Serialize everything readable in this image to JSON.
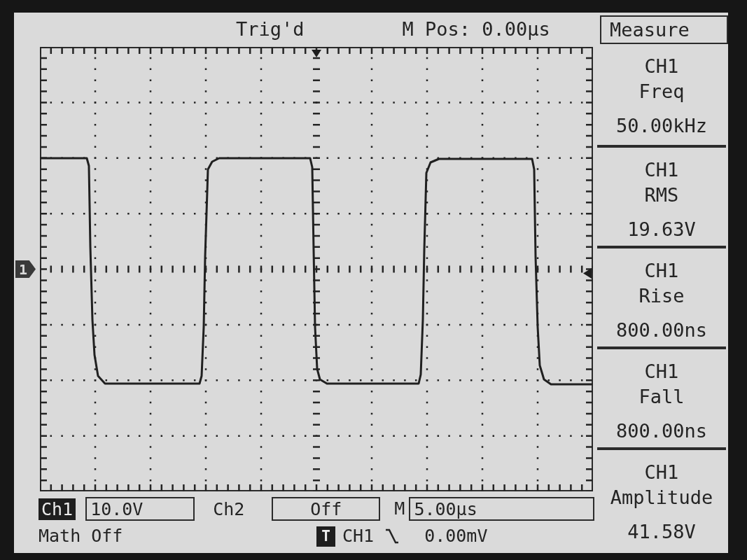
{
  "status": {
    "trigger_state": "Trig'd",
    "horizontal_position": "M Pos: 0.00µs"
  },
  "menu": {
    "title": "Measure",
    "items": [
      {
        "source": "CH1",
        "measurement": "Freq",
        "value": "50.00kHz"
      },
      {
        "source": "CH1",
        "measurement": "RMS",
        "value": "19.63V"
      },
      {
        "source": "CH1",
        "measurement": "Rise",
        "value": "800.00ns"
      },
      {
        "source": "CH1",
        "measurement": "Fall",
        "value": "800.00ns"
      },
      {
        "source": "CH1",
        "measurement": "Amplitude",
        "value": "41.58V"
      }
    ]
  },
  "display": {
    "channel_marker": "1"
  },
  "channels": [
    {
      "label": "Ch1",
      "scale": "10.0V",
      "selected": true
    },
    {
      "label": "Ch2",
      "scale": "Off",
      "selected": false
    }
  ],
  "timebase": {
    "label": "M",
    "scale": "5.00µs"
  },
  "math": "Math Off",
  "trigger": {
    "label": "T",
    "source": "CH1",
    "falling_edge": true,
    "level": "0.00mV"
  }
}
